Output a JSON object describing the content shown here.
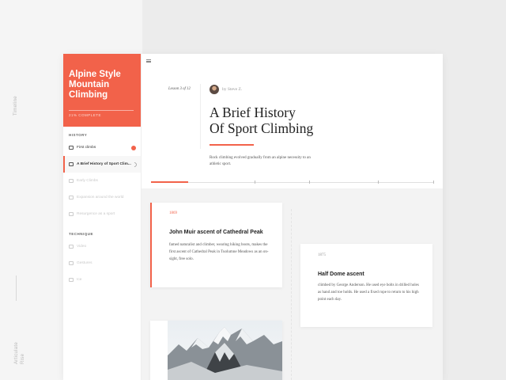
{
  "page": {
    "side_labels": [
      "Timeline",
      "Articulate Rise"
    ]
  },
  "course": {
    "title": "Alpine Style Mountain Climbing",
    "progress": "21% COMPLETE"
  },
  "sidebar": {
    "history_label": "HISTORY",
    "history_items": [
      {
        "label": "First climbs",
        "state": "badge"
      },
      {
        "label": "A Brief History of Sport Clim...",
        "state": "active"
      },
      {
        "label": "Early Climbs",
        "state": "dim"
      },
      {
        "label": "Expansion around the world",
        "state": "dim"
      },
      {
        "label": "Resurgence as a sport",
        "state": "dim"
      }
    ],
    "technique_label": "TECHNIQUE",
    "technique_items": [
      {
        "label": "Video",
        "state": "dim"
      },
      {
        "label": "Gestures",
        "state": "dim"
      },
      {
        "label": "Ice",
        "state": "dim"
      }
    ]
  },
  "lesson": {
    "counter": "Lesson 3 of 12",
    "author": "by Steve Z.",
    "title_line1": "A Brief History",
    "title_line2": "Of Sport Climbing",
    "description": "Rock climbing evolved gradually from an alpine necessity to an athletic sport.",
    "timeline_progress": 0.13
  },
  "timeline_cards": [
    {
      "year": "1869",
      "title": "John Muir ascent of Cathedral Peak",
      "body": "famed naturalist and climber, wearing hiking boots, makes the first ascent of Cathedral Peak in Tuolumne Meadows as an on-sight, free solo."
    },
    {
      "year": "1875",
      "title": "Half Dome ascent",
      "body": "climbed by George Anderson. He used eye bolts in drilled holes as hand and toe holds. He used a fixed rope to return to his high point each day."
    }
  ],
  "colors": {
    "accent": "#f2624a",
    "text": "#222222",
    "muted": "#999999"
  },
  "icons": [
    "menu-icon",
    "lesson-icon",
    "next-chevron-icon"
  ]
}
